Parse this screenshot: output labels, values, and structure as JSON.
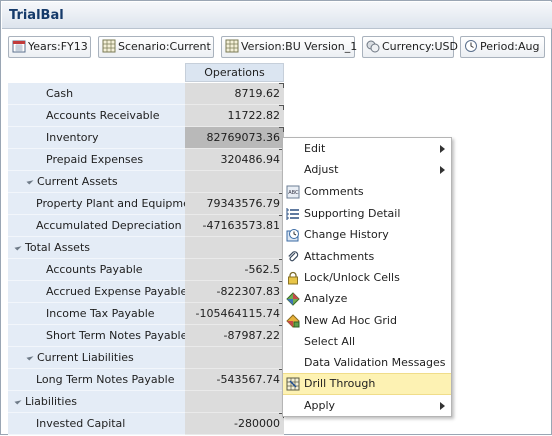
{
  "form": {
    "title": "TrialBal"
  },
  "pov": [
    {
      "label": "Years:FY13",
      "icon": "calendar-icon"
    },
    {
      "label": "Scenario:Current",
      "icon": "grid-icon"
    },
    {
      "label": "Version:BU Version_1",
      "icon": "grid-icon"
    },
    {
      "label": "Currency:USD",
      "icon": "currency-icon"
    },
    {
      "label": "Period:Aug",
      "icon": "clock-icon"
    }
  ],
  "grid": {
    "column_header": "Operations",
    "rows": [
      {
        "label": "Cash",
        "value": "8719.62",
        "indent": 3,
        "collapse": false
      },
      {
        "label": "Accounts Receivable",
        "value": "11722.82",
        "indent": 3,
        "collapse": false
      },
      {
        "label": "Inventory",
        "value": "82769073.36",
        "indent": 3,
        "collapse": false,
        "selected": true
      },
      {
        "label": "Prepaid Expenses",
        "value": "320486.94",
        "indent": 3,
        "collapse": false
      },
      {
        "label": "Current Assets",
        "value": "",
        "indent": 2,
        "collapse": true
      },
      {
        "label": "Property Plant and Equipment",
        "value": "79343576.79",
        "indent": 1,
        "collapse": false
      },
      {
        "label": "Accumulated Depreciation",
        "value": "-47163573.81",
        "indent": 1,
        "collapse": false
      },
      {
        "label": "Total Assets",
        "value": "",
        "indent": 0,
        "collapse": true
      },
      {
        "label": "Accounts Payable",
        "value": "-562.5",
        "indent": 3,
        "collapse": false
      },
      {
        "label": "Accrued Expense Payable",
        "value": "-822307.83",
        "indent": 3,
        "collapse": false
      },
      {
        "label": "Income Tax Payable",
        "value": "-105464115.74",
        "indent": 3,
        "collapse": false
      },
      {
        "label": "Short Term Notes Payable",
        "value": "-87987.22",
        "indent": 3,
        "collapse": false
      },
      {
        "label": "Current Liabilities",
        "value": "",
        "indent": 2,
        "collapse": true
      },
      {
        "label": "Long Term Notes Payable",
        "value": "-543567.74",
        "indent": 1,
        "collapse": false
      },
      {
        "label": "Liabilities",
        "value": "",
        "indent": 0,
        "collapse": true
      },
      {
        "label": "Invested Capital",
        "value": "-280000",
        "indent": 1,
        "collapse": false
      }
    ]
  },
  "context_menu": {
    "items": [
      {
        "label": "Edit",
        "submenu": true,
        "icon": ""
      },
      {
        "label": "Adjust",
        "submenu": true,
        "icon": ""
      },
      {
        "label": "Comments",
        "submenu": false,
        "icon": "comment-icon"
      },
      {
        "label": "Supporting Detail",
        "submenu": false,
        "icon": "supporting-detail-icon"
      },
      {
        "label": "Change History",
        "submenu": false,
        "icon": "history-icon"
      },
      {
        "label": "Attachments",
        "submenu": false,
        "icon": "paperclip-icon"
      },
      {
        "label": "Lock/Unlock Cells",
        "submenu": false,
        "icon": "lock-icon"
      },
      {
        "label": "Analyze",
        "submenu": false,
        "icon": "analyze-icon"
      },
      {
        "label": "New Ad Hoc Grid",
        "submenu": false,
        "icon": "adhoc-grid-icon"
      },
      {
        "label": "Select All",
        "submenu": false,
        "icon": ""
      },
      {
        "label": "Data Validation Messages",
        "submenu": false,
        "icon": ""
      },
      {
        "label": "Drill Through",
        "submenu": false,
        "icon": "drill-through-icon",
        "highlighted": true
      },
      {
        "label": "Apply",
        "submenu": true,
        "icon": ""
      }
    ]
  },
  "colors": {
    "title_text": "#153a6a",
    "label_bg": "#e4ecf6",
    "value_bg": "#dcdcdc",
    "selected_bg": "#b9b9b9",
    "highlight_bg": "#fdf2b3"
  }
}
